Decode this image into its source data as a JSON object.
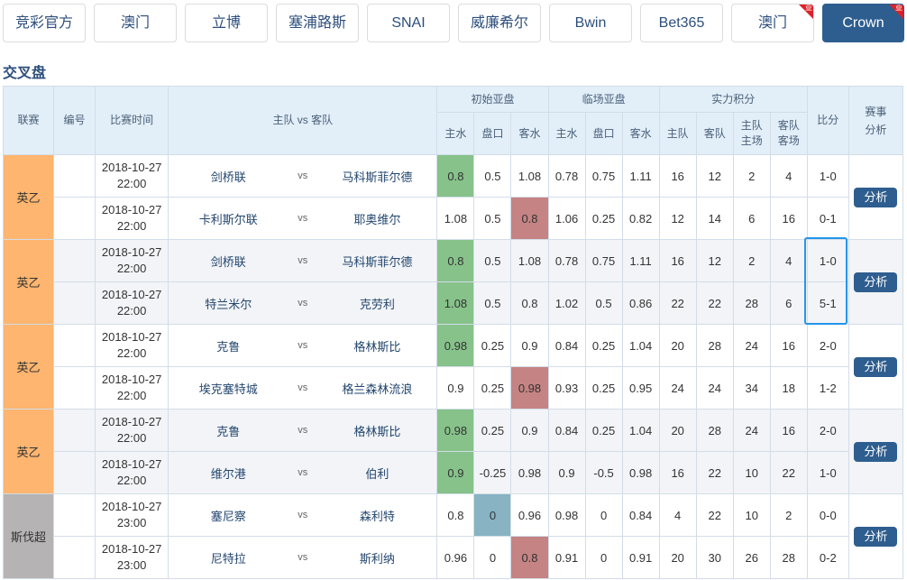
{
  "tabs": [
    {
      "label": "竞彩官方",
      "active": false,
      "badge": null
    },
    {
      "label": "澳门",
      "active": false,
      "badge": null
    },
    {
      "label": "立博",
      "active": false,
      "badge": null
    },
    {
      "label": "塞浦路斯",
      "active": false,
      "badge": null
    },
    {
      "label": "SNAI",
      "active": false,
      "badge": null
    },
    {
      "label": "威廉希尔",
      "active": false,
      "badge": null
    },
    {
      "label": "Bwin",
      "active": false,
      "badge": null
    },
    {
      "label": "Bet365",
      "active": false,
      "badge": null
    },
    {
      "label": "澳门",
      "active": false,
      "badge": "亚"
    },
    {
      "label": "Crown",
      "active": true,
      "badge": "亚"
    }
  ],
  "section_title": "交叉盘",
  "table": {
    "headers": {
      "league": "联赛",
      "number": "编号",
      "match_time": "比赛时间",
      "teams": "主队 vs 客队",
      "initial_handicap": "初始亚盘",
      "closing_handicap": "临场亚盘",
      "strength_points": "实力积分",
      "score": "比分",
      "analysis": "赛事分析",
      "home_water": "主水",
      "line": "盘口",
      "away_water": "客水",
      "home_water2": "主水",
      "line2": "盘口",
      "away_water2": "客水",
      "home_team": "主队",
      "away_team": "客队",
      "home_at_home": "主队主场",
      "away_at_away": "客队客场"
    },
    "vs_label": "vs",
    "analyze_label": "分析",
    "groups": [
      {
        "league": "英乙",
        "league_color": "orange",
        "rows": [
          {
            "date": "2018-10-27",
            "time": "22:00",
            "home": "剑桥联",
            "away": "马科斯菲尔德",
            "init": [
              "0.8",
              "0.5",
              "1.08"
            ],
            "close": [
              "0.78",
              "0.75",
              "1.11"
            ],
            "points": [
              "16",
              "12",
              "2",
              "4"
            ],
            "score": "1-0",
            "highlight": {
              "col": 0,
              "color": "green"
            }
          },
          {
            "date": "2018-10-27",
            "time": "22:00",
            "home": "卡利斯尔联",
            "away": "耶奥维尔",
            "init": [
              "1.08",
              "0.5",
              "0.8"
            ],
            "close": [
              "1.06",
              "0.25",
              "0.82"
            ],
            "points": [
              "12",
              "14",
              "6",
              "16"
            ],
            "score": "0-1",
            "highlight": {
              "col": 2,
              "color": "red"
            }
          }
        ]
      },
      {
        "league": "英乙",
        "league_color": "orange",
        "rows": [
          {
            "date": "2018-10-27",
            "time": "22:00",
            "home": "剑桥联",
            "away": "马科斯菲尔德",
            "init": [
              "0.8",
              "0.5",
              "1.08"
            ],
            "close": [
              "0.78",
              "0.75",
              "1.11"
            ],
            "points": [
              "16",
              "12",
              "2",
              "4"
            ],
            "score": "1-0",
            "highlight": {
              "col": 0,
              "color": "green"
            }
          },
          {
            "date": "2018-10-27",
            "time": "22:00",
            "home": "特兰米尔",
            "away": "克劳利",
            "init": [
              "1.08",
              "0.5",
              "0.8"
            ],
            "close": [
              "1.02",
              "0.5",
              "0.86"
            ],
            "points": [
              "22",
              "22",
              "28",
              "6"
            ],
            "score": "5-1",
            "highlight": {
              "col": 0,
              "color": "green"
            }
          }
        ]
      },
      {
        "league": "英乙",
        "league_color": "orange",
        "rows": [
          {
            "date": "2018-10-27",
            "time": "22:00",
            "home": "克鲁",
            "away": "格林斯比",
            "init": [
              "0.98",
              "0.25",
              "0.9"
            ],
            "close": [
              "0.84",
              "0.25",
              "1.04"
            ],
            "points": [
              "20",
              "28",
              "24",
              "16"
            ],
            "score": "2-0",
            "highlight": {
              "col": 0,
              "color": "green"
            }
          },
          {
            "date": "2018-10-27",
            "time": "22:00",
            "home": "埃克塞特城",
            "away": "格兰森林流浪",
            "init": [
              "0.9",
              "0.25",
              "0.98"
            ],
            "close": [
              "0.93",
              "0.25",
              "0.95"
            ],
            "points": [
              "24",
              "24",
              "34",
              "18"
            ],
            "score": "1-2",
            "highlight": {
              "col": 2,
              "color": "red"
            }
          }
        ]
      },
      {
        "league": "英乙",
        "league_color": "orange",
        "rows": [
          {
            "date": "2018-10-27",
            "time": "22:00",
            "home": "克鲁",
            "away": "格林斯比",
            "init": [
              "0.98",
              "0.25",
              "0.9"
            ],
            "close": [
              "0.84",
              "0.25",
              "1.04"
            ],
            "points": [
              "20",
              "28",
              "24",
              "16"
            ],
            "score": "2-0",
            "highlight": {
              "col": 0,
              "color": "green"
            }
          },
          {
            "date": "2018-10-27",
            "time": "22:00",
            "home": "维尔港",
            "away": "伯利",
            "init": [
              "0.9",
              "-0.25",
              "0.98"
            ],
            "close": [
              "0.9",
              "-0.5",
              "0.98"
            ],
            "points": [
              "16",
              "22",
              "10",
              "22"
            ],
            "score": "1-0",
            "highlight": {
              "col": 0,
              "color": "green"
            }
          }
        ]
      },
      {
        "league": "斯伐超",
        "league_color": "gray",
        "rows": [
          {
            "date": "2018-10-27",
            "time": "23:00",
            "home": "塞尼察",
            "away": "森利特",
            "init": [
              "0.8",
              "0",
              "0.96"
            ],
            "close": [
              "0.98",
              "0",
              "0.84"
            ],
            "points": [
              "4",
              "22",
              "10",
              "2"
            ],
            "score": "0-0",
            "highlight": {
              "col": 1,
              "color": "blue"
            }
          },
          {
            "date": "2018-10-27",
            "time": "23:00",
            "home": "尼特拉",
            "away": "斯利纳",
            "init": [
              "0.96",
              "0",
              "0.8"
            ],
            "close": [
              "0.91",
              "0",
              "0.91"
            ],
            "points": [
              "20",
              "30",
              "26",
              "28"
            ],
            "score": "0-2",
            "highlight": {
              "col": 2,
              "color": "red"
            }
          }
        ]
      }
    ],
    "selected_score_group": 1
  },
  "colors": {
    "accent": "#2e5e8f",
    "league_orange": "#fdb56f",
    "league_gray": "#b5b3b3",
    "highlight_green": "#86c28a",
    "highlight_red": "#c58383",
    "highlight_blue": "#87b3c3",
    "score_red": "#d0504d",
    "focus_blue": "#2496ea"
  }
}
